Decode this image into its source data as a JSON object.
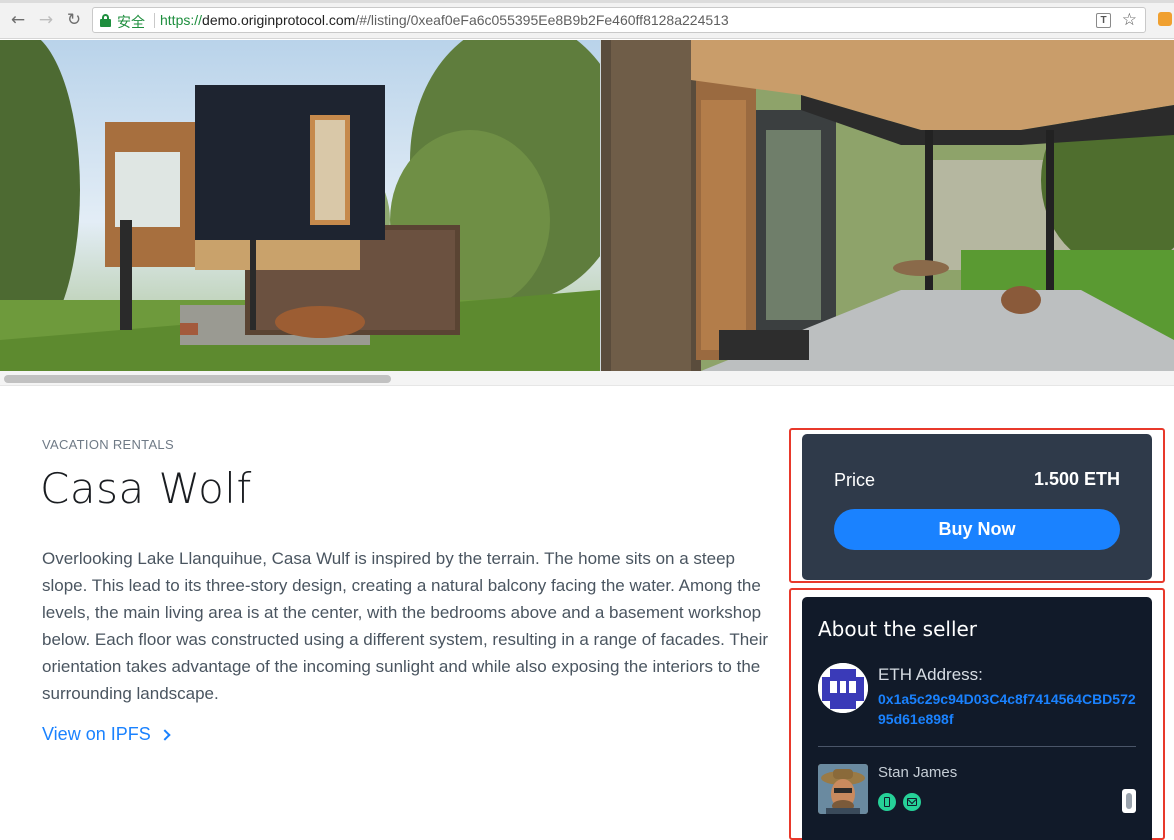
{
  "browser": {
    "secure_label": "安全",
    "url_scheme": "https://",
    "url_host": "demo.originprotocol.com",
    "url_path": "/#/listing/0xeaf0eFa6c055395Ee8B9b2Fe460ff8128a224513",
    "nav_icons": [
      "back-arrow-icon",
      "forward-arrow-icon",
      "reload-icon"
    ]
  },
  "listing": {
    "category": "VACATION RENTALS",
    "title": "Casa Wolf",
    "description": "Overlooking Lake Llanquihue, Casa Wulf is inspired by the terrain. The home sits on a steep slope. This lead to its three-story design, creating a natural balcony facing the water. Among the levels, the main living area is at the center, with the bedrooms above and a basement workshop below. Each floor was constructed using a different system, resulting in a range of facades. Their orientation takes advantage of the incoming sunlight and while also exposing the interiors to the surrounding landscape.",
    "ipfs_link": "View on IPFS"
  },
  "buy": {
    "price_label": "Price",
    "price_value": "1.500 ETH",
    "button_label": "Buy Now"
  },
  "seller": {
    "heading": "About the seller",
    "eth_label": "ETH Address:",
    "eth_address": "0x1a5c29c94D03C4c8f7414564CBD57295d61e898f",
    "name": "Stan James",
    "badges": [
      "phone-verified-icon",
      "email-verified-icon"
    ]
  },
  "colors": {
    "accent": "#1a82ff",
    "buy_panel": "#2f3a4a",
    "seller_panel": "#111a29",
    "annotation": "#e8392b",
    "badge": "#26d198"
  }
}
